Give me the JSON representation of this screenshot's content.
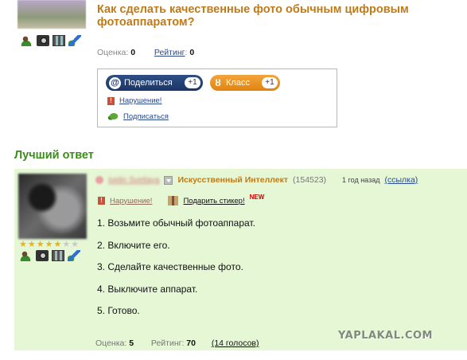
{
  "question": {
    "title": "Как сделать качественные фото обычным цифровым фотоаппаратом?",
    "score_label": "Оценка:",
    "score_value": "0",
    "rating_label": "Рейтинг",
    "rating_value": "0"
  },
  "user_icons": [
    "user-icon",
    "camera-icon",
    "film-icon",
    "pen-icon"
  ],
  "share": {
    "mail_label": "Поделиться",
    "mail_count": "+1",
    "ok_label": "Класс",
    "ok_count": "+1",
    "report_label": "Нарушение!",
    "subscribe_label": "Подписаться"
  },
  "best_answer": {
    "header": "Лучший ответ",
    "author_name": "Ivelin Svetlaya",
    "rank": "Искусственный Интеллект",
    "points": "(154523)",
    "time_ago": "1 год назад",
    "source_link": "(ссылка)",
    "report_label": "Нарушение!",
    "sticker_label": "Подарить стикер!",
    "new_badge": "NEW",
    "stars": {
      "filled": 5,
      "total": 7
    },
    "steps": [
      "1. Возьмите обычный фотоаппарат.",
      "2. Включите его.",
      "3. Сделайте качественные фото.",
      "4. Выключите аппарат.",
      "5. Готово."
    ],
    "score_label": "Оценка:",
    "score_value": "5",
    "rating_label": "Рейтинг:",
    "rating_value": "70",
    "votes_link": "(14 голосов)"
  },
  "watermark": "YAPLAKAL.COM",
  "colors": {
    "title_orange": "#c07a16",
    "best_green": "#3b8c1a",
    "answer_bg": "#e6f7d6",
    "mail_blue": "#1c3566",
    "ok_orange": "#e08410"
  }
}
